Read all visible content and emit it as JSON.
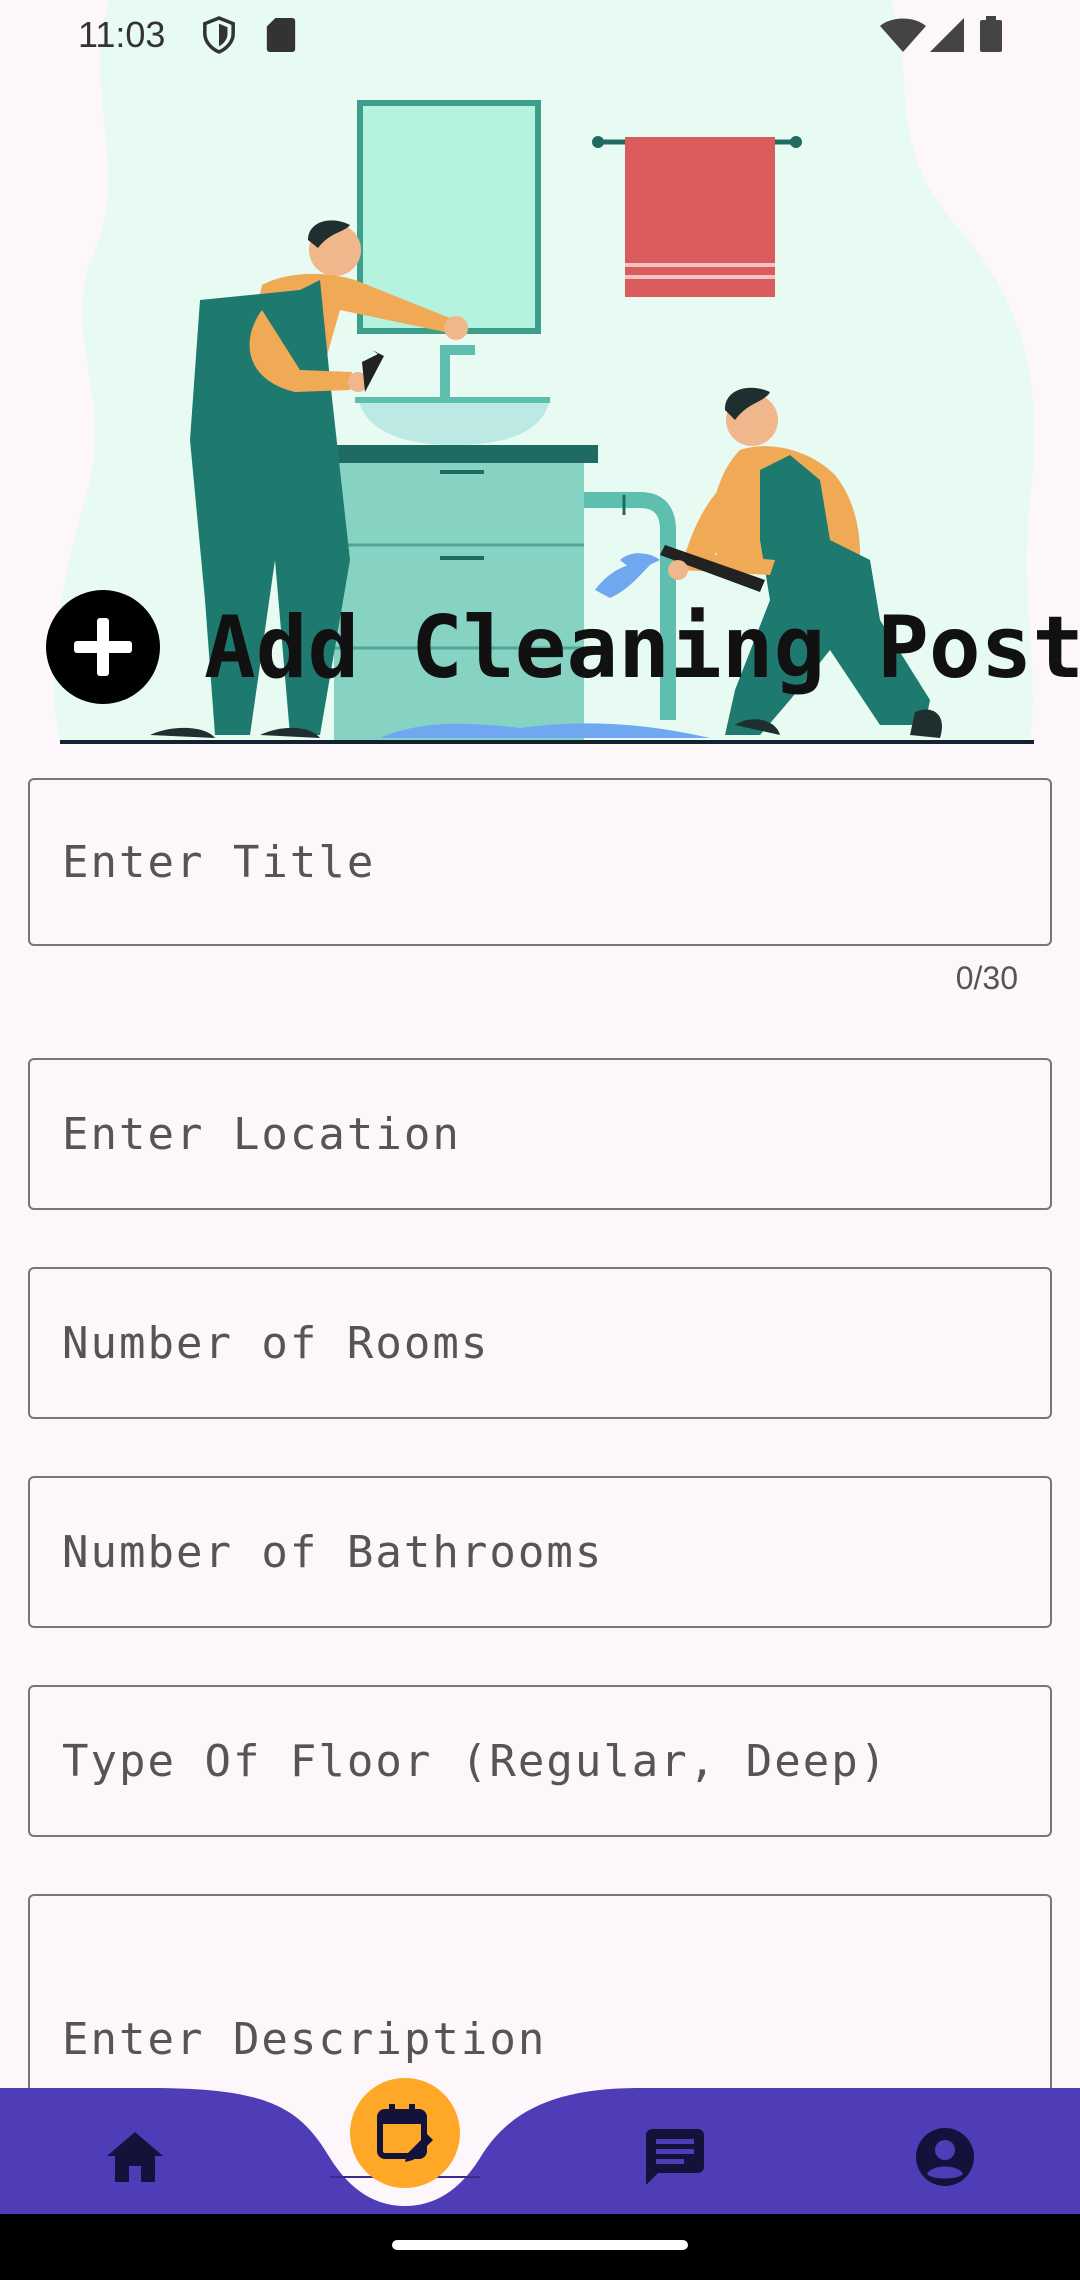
{
  "status": {
    "time": "11:03",
    "icons": [
      "shield-icon",
      "sd-card-icon",
      "wifi-icon",
      "signal-icon",
      "battery-icon"
    ]
  },
  "header": {
    "title": "Add Cleaning Post",
    "illustration": "plumbers-bathroom-illustration"
  },
  "form": {
    "title_placeholder": "Enter Title",
    "title_counter": "0/30",
    "location_placeholder": "Enter Location",
    "rooms_placeholder": "Number of Rooms",
    "bathrooms_placeholder": "Number of Bathrooms",
    "floor_placeholder": "Type Of Floor (Regular, Deep)",
    "description_placeholder": "Enter Description"
  },
  "bottom_nav": {
    "items": [
      "home-icon",
      "calendar-edit-icon",
      "chat-icon",
      "account-icon"
    ],
    "bar_color": "#4F3DB8",
    "fab_color": "#FFA726"
  },
  "colors": {
    "background": "#FDF6FB",
    "hero_blob": "#E8FBF3"
  }
}
